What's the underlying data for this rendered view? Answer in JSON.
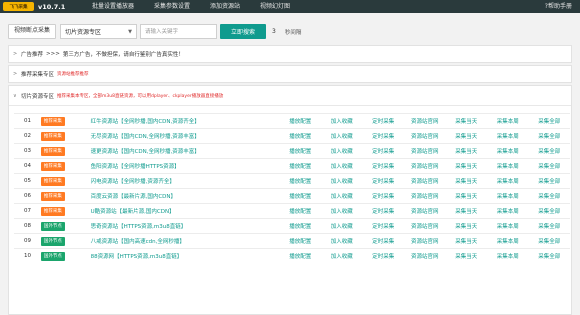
{
  "header": {
    "logo_text": "飞飞采集",
    "version": "v10.7.1",
    "nav": [
      "批量设置播放器",
      "采集参数设置",
      "添加资源站",
      "视频幻灯图"
    ],
    "help": "帮助手册"
  },
  "search": {
    "quick_btn": "视频断点采集",
    "select_value": "切片资源专区",
    "placeholder": "请输入关键字",
    "submit": "立即搜索",
    "count": "3",
    "unit": "秒间隔"
  },
  "panels": {
    "ad": {
      "title": "广告推荐",
      "note": "第三方广告，不做担保，请自行鉴别广告真实性！"
    },
    "recommend": {
      "title": "推荐采集专区",
      "note": "资源站推荐推荐"
    },
    "slice": {
      "title": "切片资源专区",
      "note": "推荐采集本专区，全部m3u8直链资源，可以用dplayer、ckplayer播放器直接播放"
    }
  },
  "actions": [
    "播放配置",
    "加入收藏",
    "定时采集",
    "资源站官网",
    "采集当天",
    "采集本周",
    "采集全部"
  ],
  "rows": [
    {
      "num": "01",
      "tag": "推荐采集",
      "tag_type": "orange",
      "name": "红牛资源站【全网秒播,国内CDN,资源齐全】"
    },
    {
      "num": "02",
      "tag": "推荐采集",
      "tag_type": "orange",
      "name": "无尽资源站【国内CDN,全网秒播,资源丰富】"
    },
    {
      "num": "03",
      "tag": "推荐采集",
      "tag_type": "orange",
      "name": "速更资源站【国内CDN,全网秒播,资源丰富】"
    },
    {
      "num": "04",
      "tag": "推荐采集",
      "tag_type": "orange",
      "name": "鱼阳资源站【全网秒播HTTPS资源】"
    },
    {
      "num": "05",
      "tag": "推荐采集",
      "tag_type": "orange",
      "name": "闪电资源站【全网秒播,资源齐全】"
    },
    {
      "num": "06",
      "tag": "推荐采集",
      "tag_type": "orange",
      "name": "百度云资源【最新片源,国内CDN】"
    },
    {
      "num": "07",
      "tag": "推荐采集",
      "tag_type": "orange",
      "name": "U酷资源站【最新片源,国内CDN】"
    },
    {
      "num": "08",
      "tag": "国外节点",
      "tag_type": "green",
      "name": "思奇资源站【HTTPS资源,m3u8直链】"
    },
    {
      "num": "09",
      "tag": "国外节点",
      "tag_type": "green",
      "name": "八戒资源站【国内高速cdn,全网秒播】"
    },
    {
      "num": "10",
      "tag": "国外节点",
      "tag_type": "green",
      "name": "88资源网【HTTPS资源,m3u8直链】"
    }
  ]
}
